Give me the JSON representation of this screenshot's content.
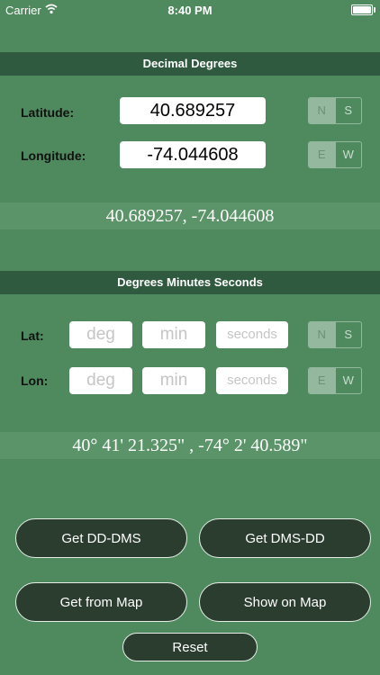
{
  "status_bar": {
    "carrier": "Carrier",
    "time": "8:40 PM"
  },
  "decimal_degrees": {
    "title": "Decimal Degrees",
    "latitude_label": "Latitude:",
    "longitude_label": "Longitude:",
    "latitude_value": "40.689257",
    "longitude_value": "-74.044608",
    "ns_segment": [
      "N",
      "S"
    ],
    "ew_segment": [
      "E",
      "W"
    ],
    "result": "40.689257, -74.044608"
  },
  "dms": {
    "title": "Degrees Minutes Seconds",
    "lat_label": "Lat:",
    "lon_label": "Lon:",
    "deg_placeholder": "deg",
    "min_placeholder": "min",
    "seconds_placeholder": "seconds",
    "ns_segment": [
      "N",
      "S"
    ],
    "ew_segment": [
      "E",
      "W"
    ],
    "result": "40° 41' 21.325\" , -74° 2' 40.589\""
  },
  "buttons": {
    "get_dd_dms": "Get DD-DMS",
    "get_dms_dd": "Get DMS-DD",
    "get_from_map": "Get from Map",
    "show_on_map": "Show on Map",
    "reset": "Reset"
  },
  "colors": {
    "background": "#4f8a5e",
    "section_bar": "#2f5a3f",
    "button": "#2b3d2f",
    "result_band": "#5b9468"
  }
}
